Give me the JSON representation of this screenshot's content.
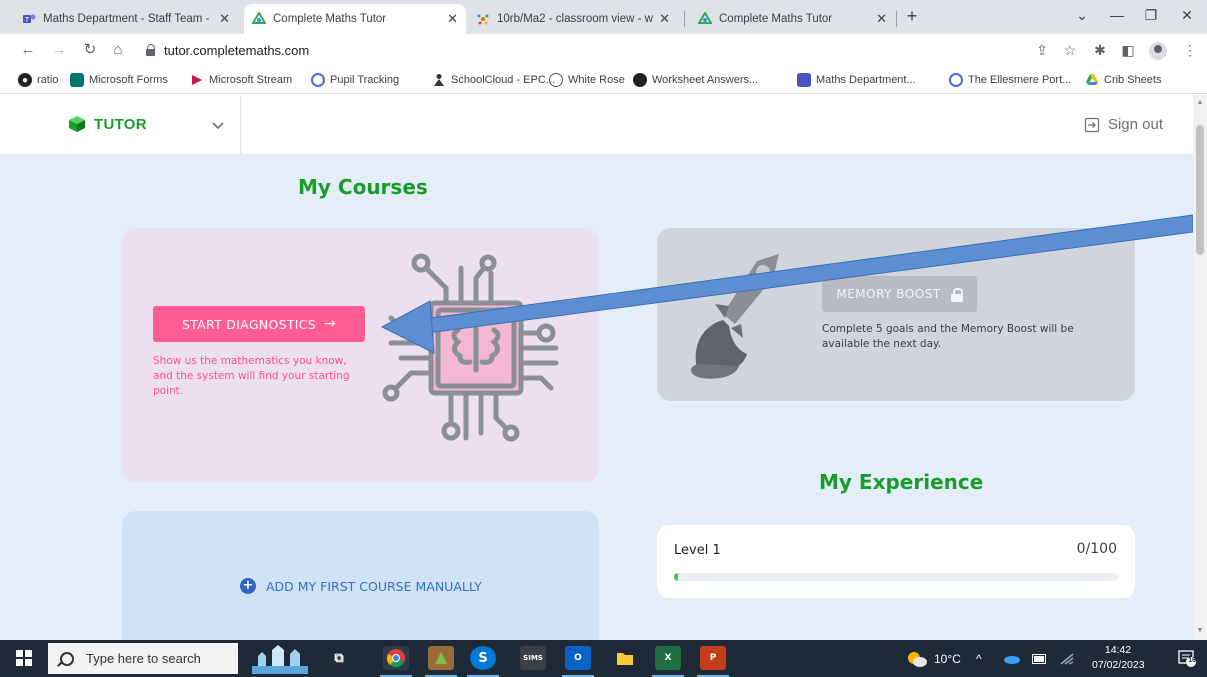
{
  "browser": {
    "tabs": [
      {
        "title": "Maths Department - Staff Team -",
        "active": false
      },
      {
        "title": "Complete Maths Tutor",
        "active": true
      },
      {
        "title": "10rb/Ma2 - classroom view - ww",
        "active": false
      },
      {
        "title": "Complete Maths Tutor",
        "active": false
      }
    ],
    "url": "tutor.completemaths.com",
    "bookmarks": [
      "ratio",
      "Microsoft Forms",
      "Microsoft Stream",
      "Pupil Tracking",
      "SchoolCloud - EPC...",
      "White Rose",
      "Worksheet Answers...",
      "Maths Department...",
      "The Ellesmere Port...",
      "Crib Sheets"
    ]
  },
  "header": {
    "brand": "TUTOR",
    "sign_out": "Sign out"
  },
  "courses": {
    "title": "My Courses",
    "diagnostics_button": "START DIAGNOSTICS",
    "diagnostics_text": "Show us the mathematics you know, and the system will find your starting point.",
    "add_course": "ADD MY FIRST COURSE MANUALLY"
  },
  "memory_boost": {
    "button": "MEMORY BOOST",
    "text": "Complete 5 goals and the Memory Boost will be available the next day."
  },
  "experience": {
    "title": "My Experience",
    "level": "Level 1",
    "score": "0/100",
    "progress_fraction": 0.0
  },
  "taskbar": {
    "search_placeholder": "Type here to search",
    "weather": "10°C",
    "time": "14:42",
    "date": "07/02/2023",
    "notifications": "16"
  },
  "colors": {
    "brand_green": "#1a9c2c",
    "diagnostics_pink": "#ff5c94",
    "annotation_blue": "#5b8fd1"
  }
}
